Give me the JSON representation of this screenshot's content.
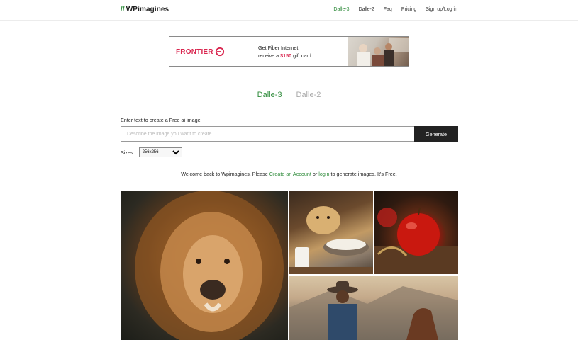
{
  "header": {
    "logo_slash": "//",
    "logo_text": "WPimagines",
    "nav": [
      {
        "label": "Dalle-3",
        "active": true
      },
      {
        "label": "Dalle-2",
        "active": false
      },
      {
        "label": "Faq",
        "active": false
      },
      {
        "label": "Pricing",
        "active": false
      },
      {
        "label": "Sign up/Log in",
        "active": false
      }
    ]
  },
  "ad": {
    "brand": "FRONTIER",
    "line1": "Get Fiber Internet",
    "line2_prefix": "receive a ",
    "line2_highlight": "$150",
    "line2_suffix": " gift card"
  },
  "tabs": {
    "active": "Dalle-3",
    "inactive": "Dalle-2"
  },
  "form": {
    "label": "Enter text to create a Free ai image",
    "placeholder": "Describe the image you want to create",
    "button": "Generate",
    "sizes_label": "Sizes:",
    "sizes_selected": "256x256"
  },
  "welcome": {
    "prefix": "Welcome back to Wpimagines. Please ",
    "create_link": "Create an Account",
    "middle": " or ",
    "login_link": "login",
    "suffix": " to generate images. It's Free."
  },
  "colors": {
    "accent": "#2e8b3a",
    "brand_red": "#d9264f",
    "button_dark": "#222222"
  }
}
